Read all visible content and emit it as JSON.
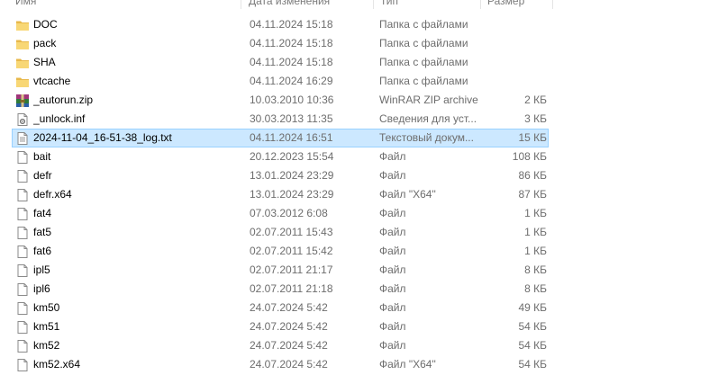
{
  "columns": {
    "name": "Имя",
    "date": "Дата изменения",
    "type": "Тип",
    "size": "Размер"
  },
  "colors": {
    "selection_bg": "#cce8ff",
    "selection_border": "#99d1ff",
    "folder": "#f8d775",
    "folder_dark": "#e8b84a"
  },
  "files": [
    {
      "name": "DOC",
      "date": "04.11.2024 15:18",
      "type": "Папка с файлами",
      "size": "",
      "icon": "folder-icon"
    },
    {
      "name": "pack",
      "date": "04.11.2024 15:18",
      "type": "Папка с файлами",
      "size": "",
      "icon": "folder-icon"
    },
    {
      "name": "SHA",
      "date": "04.11.2024 15:18",
      "type": "Папка с файлами",
      "size": "",
      "icon": "folder-icon"
    },
    {
      "name": "vtcache",
      "date": "04.11.2024 16:29",
      "type": "Папка с файлами",
      "size": "",
      "icon": "folder-icon"
    },
    {
      "name": "_autorun.zip",
      "date": "10.03.2010 10:36",
      "type": "WinRAR ZIP archive",
      "size": "2 КБ",
      "icon": "winrar-archive-icon"
    },
    {
      "name": "_unlock.inf",
      "date": "30.03.2013 11:35",
      "type": "Сведения для уст...",
      "size": "3 КБ",
      "icon": "setup-info-icon"
    },
    {
      "name": "2024-11-04_16-51-38_log.txt",
      "date": "04.11.2024 16:51",
      "type": "Текстовый докум...",
      "size": "15 КБ",
      "icon": "text-document-icon",
      "selected": true
    },
    {
      "name": "bait",
      "date": "20.12.2023 15:54",
      "type": "Файл",
      "size": "108 КБ",
      "icon": "file-icon"
    },
    {
      "name": "defr",
      "date": "13.01.2024 23:29",
      "type": "Файл",
      "size": "86 КБ",
      "icon": "file-icon"
    },
    {
      "name": "defr.x64",
      "date": "13.01.2024 23:29",
      "type": "Файл \"X64\"",
      "size": "87 КБ",
      "icon": "file-icon"
    },
    {
      "name": "fat4",
      "date": "07.03.2012 6:08",
      "type": "Файл",
      "size": "1 КБ",
      "icon": "file-icon"
    },
    {
      "name": "fat5",
      "date": "02.07.2011 15:43",
      "type": "Файл",
      "size": "1 КБ",
      "icon": "file-icon"
    },
    {
      "name": "fat6",
      "date": "02.07.2011 15:42",
      "type": "Файл",
      "size": "1 КБ",
      "icon": "file-icon"
    },
    {
      "name": "ipl5",
      "date": "02.07.2011 21:17",
      "type": "Файл",
      "size": "8 КБ",
      "icon": "file-icon"
    },
    {
      "name": "ipl6",
      "date": "02.07.2011 21:18",
      "type": "Файл",
      "size": "8 КБ",
      "icon": "file-icon"
    },
    {
      "name": "km50",
      "date": "24.07.2024 5:42",
      "type": "Файл",
      "size": "49 КБ",
      "icon": "file-icon"
    },
    {
      "name": "km51",
      "date": "24.07.2024 5:42",
      "type": "Файл",
      "size": "54 КБ",
      "icon": "file-icon"
    },
    {
      "name": "km52",
      "date": "24.07.2024 5:42",
      "type": "Файл",
      "size": "54 КБ",
      "icon": "file-icon"
    },
    {
      "name": "km52.x64",
      "date": "24.07.2024 5:42",
      "type": "Файл \"X64\"",
      "size": "54 КБ",
      "icon": "file-icon"
    }
  ]
}
